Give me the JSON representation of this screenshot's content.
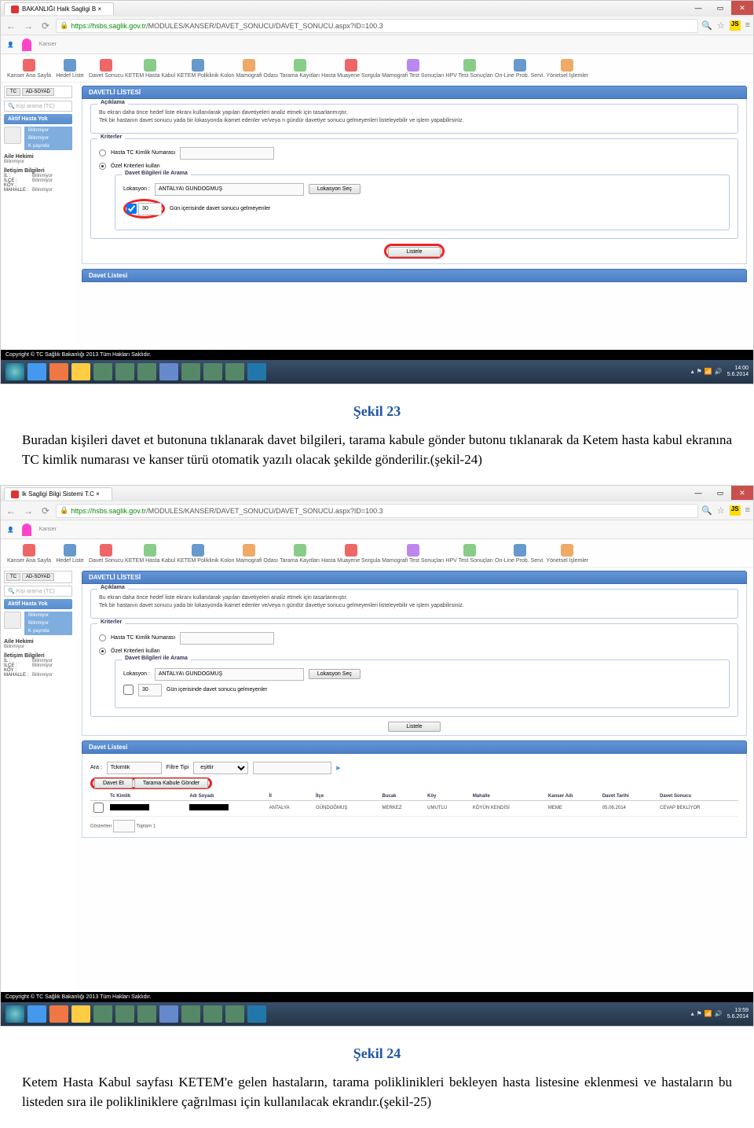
{
  "screenshot1": {
    "browser_tab": "BAKANLIĞI Halk Sagligi B  ×",
    "url_host": "https://hsbs.saglik.gov.tr",
    "url_path": "/MODULES/KANSER/DAVET_SONUCU/DAVET_SONUCU.aspx?ID=100.3",
    "toolbar_items": [
      "Kanser Ana Sayfa",
      "Hedef Liste",
      "Davet Sonucu",
      "KETEM Hasta Kabul",
      "KETEM Poliklinik",
      "Kolon Mamografi Odası",
      "Tarama Kayıtları",
      "Hasta Muayene Sorgula",
      "Mamografi Test Sonuçları",
      "HPV Test Sonuçları",
      "On-Line Prob. Servi.",
      "Yönetsel İşlemler"
    ],
    "sidebar": {
      "tc_btn": "TC",
      "ad_btn": "AD-SOYAD",
      "search_placeholder": "Kişi arama (TC)",
      "aktif_hasta": "Aktif Hasta Yok",
      "bilinmiyor": "Bilinmiyor",
      "k_yasinda": "K yaşında",
      "aile_hekimi": "Aile Hekimi",
      "aile_val": "Bilinmiyor",
      "iletisim": "İletişim Bilgileri",
      "il_k": "İL :",
      "il_v": "Bilinmiyor",
      "ilce_k": "İLÇE :",
      "ilce_v": "Bilinmiyor",
      "koy_k": "KÖY :",
      "mah_k": "MAHALLE :",
      "mah_v": "Bilinmiyor"
    },
    "panel_title": "DAVETLİ LİSTESİ",
    "aciklama_title": "Açıklama",
    "aciklama_text1": "Bu ekran daha önce hedef liste ekranı kullanılarak yapılan davetiyeleri analiz etmek için tasarlanmıştır.",
    "aciklama_text2": "Tek bir hastanın davet sonucu yada bir lokasyonda ikamet edenler ve/veya n gündür davetiye sonucu gelmeyenleri listeleyebilir ve işlem yapabilirsiniz.",
    "kriterler_title": "Kriterler",
    "radio_tc": "Hasta TC Kimlik Numarası",
    "radio_ozel": "Özel Kriterleri kullan",
    "davet_bilgileri_title": "Davet Bilgileri ile Arama",
    "lokasyon_label": "Lokasyon :",
    "lokasyon_value": "ANTALYA\\ GÜNDOĞMUŞ",
    "lokasyon_btn": "Lokasyon Seç",
    "gun_value": "30",
    "gun_text": "Gün içerisinde davet sonucu gelmeyenler",
    "listele_btn": "Listele",
    "davet_listesi_title": "Davet Listesi",
    "copyright": "Copyright © TC Sağlık Bakanlığı 2013 Tüm Hakları Saklıdır.",
    "time": "14:00",
    "date": "5.6.2014"
  },
  "caption1": "Şekil 23",
  "para1": "Buradan kişileri davet et butonuna tıklanarak davet bilgileri, tarama kabule gönder butonu tıklanarak da Ketem hasta kabul ekranına TC kimlik numarası ve kanser türü otomatik yazılı olacak şekilde gönderilir.(şekil-24)",
  "screenshot2": {
    "browser_tab": "lk Sagligi Bilgi Sistemi T.C  ×",
    "url_host": "https://hsbs.saglik.gov.tr",
    "url_path": "/MODULES/KANSER/DAVET_SONUCU/DAVET_SONUCU.aspx?ID=100.3",
    "results": {
      "ara_label": "Ara :",
      "ara_value": "Tckimlik",
      "filtre_label": "Filtre Tipi",
      "filtre_value": "eşittir",
      "btn1": "Davet Et",
      "btn2": "Tarama Kabule Gönder",
      "headers": [
        "Tc Kimlik",
        "Adı Soyadı",
        "İl",
        "İlçe",
        "Bucak",
        "Köy",
        "Mahalle",
        "Kanser Adı",
        "Davet Tarihi",
        "Davet Sonucu"
      ],
      "row": [
        "",
        "",
        "ANTALYA",
        "GÜNDOĞMUŞ",
        "MERKEZ",
        "UMUTLU",
        "KÖYÜN KENDİSİ",
        "MEME",
        "05.06.2014",
        "CEVAP BEKLİYOR"
      ],
      "gosterilen": "Gösterilen",
      "toplam": "Toplam 1"
    },
    "time": "13:59",
    "date": "5.6.2014"
  },
  "caption2": "Şekil 24",
  "para2": "Ketem Hasta Kabul sayfası KETEM'e gelen hastaların, tarama poliklinikleri bekleyen hasta listesine eklenmesi ve hastaların bu listeden sıra ile polikliniklere çağrılması için kullanılacak ekrandır.(şekil-25)"
}
